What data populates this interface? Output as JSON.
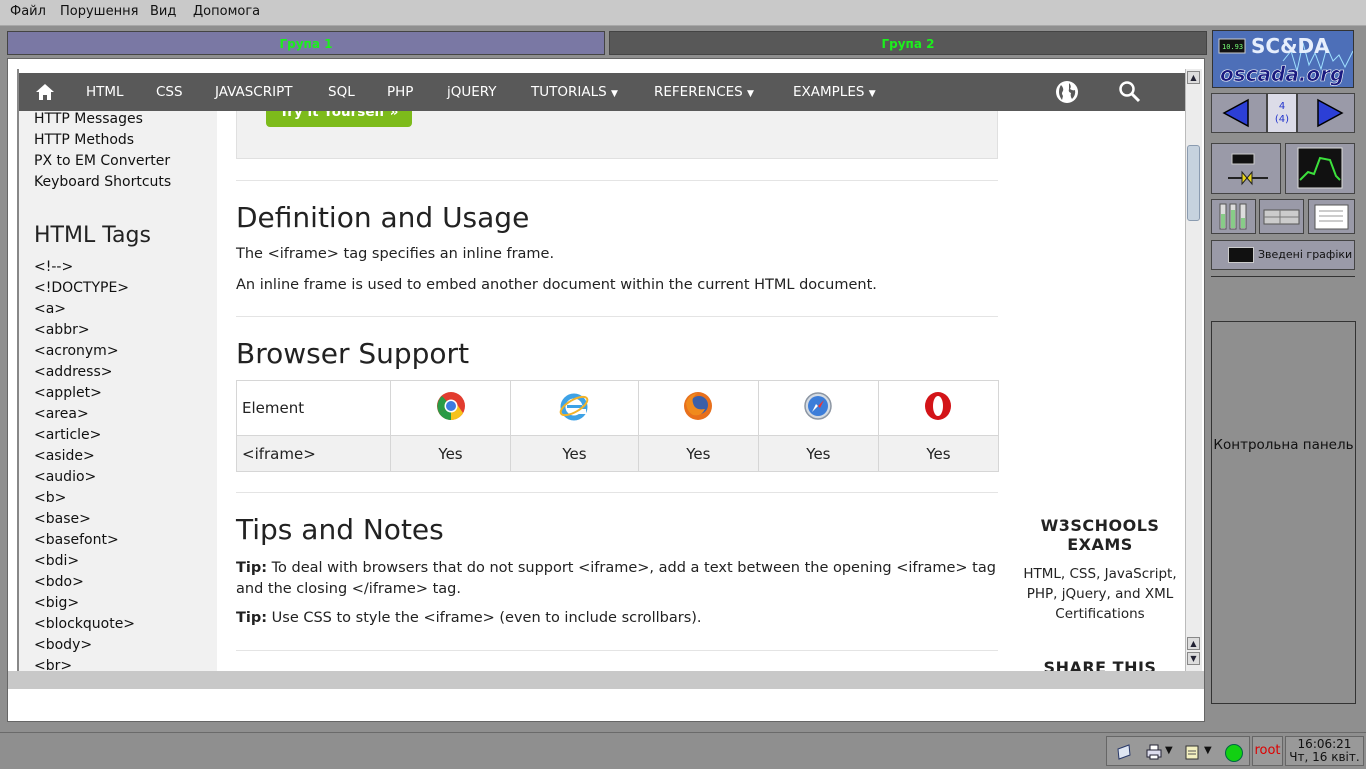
{
  "menubar": {
    "items": [
      "Файл",
      "Порушення",
      "Вид",
      "Допомога"
    ]
  },
  "groups": {
    "tab1": "Група 1",
    "tab2": "Група 2"
  },
  "nav": {
    "links": [
      "HTML",
      "CSS",
      "JAVASCRIPT",
      "SQL",
      "PHP",
      "jQUERY",
      "TUTORIALS",
      "REFERENCES",
      "EXAMPLES"
    ],
    "icons": [
      "home-icon",
      "globe-icon",
      "search-icon"
    ]
  },
  "sidebar": {
    "links_top": [
      "HTTP Messages",
      "HTTP Methods",
      "PX to EM Converter",
      "Keyboard Shortcuts"
    ],
    "heading": "HTML Tags",
    "tags": [
      "<!-->",
      "<!DOCTYPE>",
      "<a>",
      "<abbr>",
      "<acronym>",
      "<address>",
      "<applet>",
      "<area>",
      "<article>",
      "<aside>",
      "<audio>",
      "<b>",
      "<base>",
      "<basefont>",
      "<bdi>",
      "<bdo>",
      "<big>",
      "<blockquote>",
      "<body>",
      "<br>"
    ]
  },
  "main": {
    "try_button": "Try it Yourself »",
    "definition_heading": "Definition and Usage",
    "definition_p1": "The <iframe> tag specifies an inline frame.",
    "definition_p2": "An inline frame is used to embed another document within the current HTML document.",
    "support_heading": "Browser Support",
    "support_table": {
      "first_col_header": "Element",
      "browsers": [
        "chrome-icon",
        "ie-icon",
        "firefox-icon",
        "safari-icon",
        "opera-icon"
      ],
      "row_label": "<iframe>",
      "values": [
        "Yes",
        "Yes",
        "Yes",
        "Yes",
        "Yes"
      ]
    },
    "tips_heading": "Tips and Notes",
    "tip_label": "Tip:",
    "tip1": "To deal with browsers that do not support <iframe>, add a text between the opening <iframe> tag and the closing </iframe> tag.",
    "tip2": "Use CSS to style the <iframe> (even to include scrollbars)."
  },
  "right": {
    "exams_title": "W3SCHOOLS EXAMS",
    "exams_text": "HTML, CSS, JavaScript, PHP, jQuery, and XML Certifications",
    "share_title": "SHARE THIS"
  },
  "panel": {
    "logo_top": "SC&DA",
    "logo_bottom": "oscada.org",
    "page_counter": "4",
    "page_total": "(4)",
    "graphs_button": "Зведені графіки",
    "control_panel": "Контрольна панель"
  },
  "taskbar": {
    "user": "root",
    "time": "16:06:21",
    "date": "Чт, 16 квіт."
  },
  "colors": {
    "accent_green": "#1cf01c",
    "w3_green": "#7dbb1b",
    "status_led": "#12d012"
  }
}
